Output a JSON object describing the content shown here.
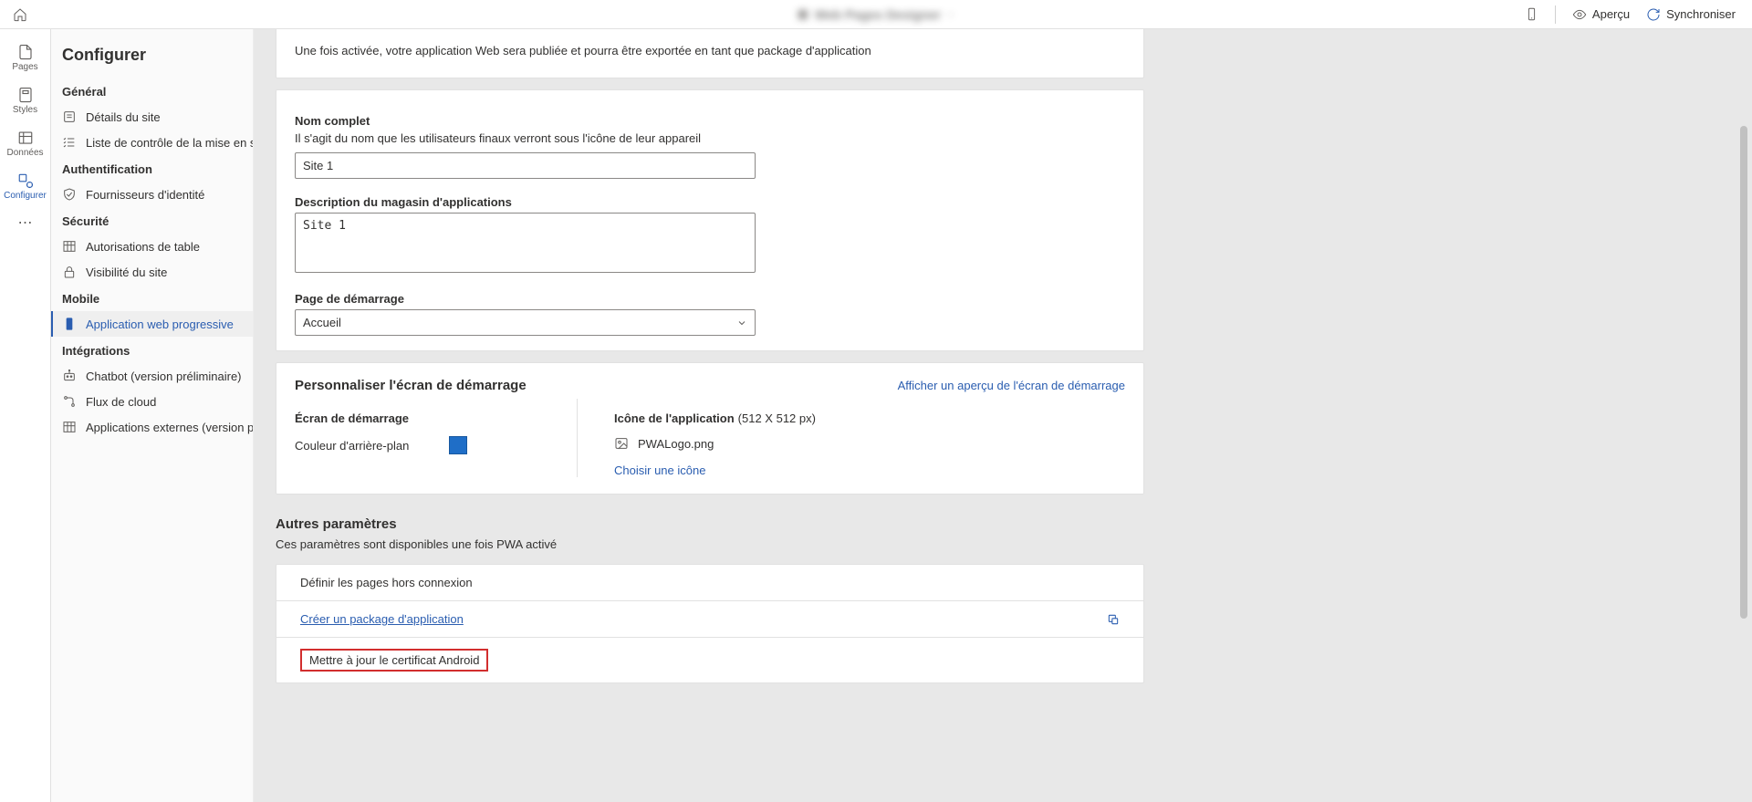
{
  "topbar": {
    "center_title_blur": "Web Pages Designer",
    "preview": "Aperçu",
    "sync": "Synchroniser"
  },
  "rail": {
    "pages": "Pages",
    "styles": "Styles",
    "data": "Données",
    "configure": "Configurer"
  },
  "sidebar": {
    "title": "Configurer",
    "groups": [
      {
        "label": "Général",
        "items": [
          {
            "icon": "info",
            "label": "Détails du site"
          },
          {
            "icon": "checklist",
            "label": "Liste de contrôle de la mise en ser..."
          }
        ]
      },
      {
        "label": "Authentification",
        "items": [
          {
            "icon": "shield",
            "label": "Fournisseurs d'identité"
          }
        ]
      },
      {
        "label": "Sécurité",
        "items": [
          {
            "icon": "table",
            "label": "Autorisations de table"
          },
          {
            "icon": "lock",
            "label": "Visibilité du site"
          }
        ]
      },
      {
        "label": "Mobile",
        "items": [
          {
            "icon": "phone",
            "label": "Application web progressive",
            "active": true
          }
        ]
      },
      {
        "label": "Intégrations",
        "items": [
          {
            "icon": "bot",
            "label": "Chatbot (version préliminaire)"
          },
          {
            "icon": "flow",
            "label": "Flux de cloud"
          },
          {
            "icon": "table",
            "label": "Applications externes (version prél..."
          }
        ]
      }
    ]
  },
  "main": {
    "activation_note": "Une fois activée, votre application Web sera publiée et pourra être exportée en tant que package d'application",
    "full_name": {
      "label": "Nom complet",
      "sub": "Il s'agit du nom que les utilisateurs finaux verront sous l'icône de leur appareil",
      "value": "Site 1"
    },
    "description": {
      "label": "Description du magasin d'applications",
      "value": "Site 1"
    },
    "start_page": {
      "label": "Page de démarrage",
      "value": "Accueil"
    },
    "splash": {
      "heading": "Personnaliser l'écran de démarrage",
      "preview_link": "Afficher un aperçu de l'écran de démarrage",
      "screen_label": "Écran de démarrage",
      "bg_label": "Couleur d'arrière-plan",
      "bg_color": "#1f6ec7",
      "icon_label": "Icône de l'application",
      "icon_dim": "(512 X 512 px)",
      "icon_file": "PWALogo.png",
      "choose_icon": "Choisir une icône"
    },
    "other": {
      "heading": "Autres paramètres",
      "sub": "Ces paramètres sont disponibles une fois PWA activé",
      "rows": {
        "offline": "Définir les pages hors connexion",
        "package": "Créer un package d'application",
        "android_cert": "Mettre à jour le certificat Android"
      }
    }
  }
}
